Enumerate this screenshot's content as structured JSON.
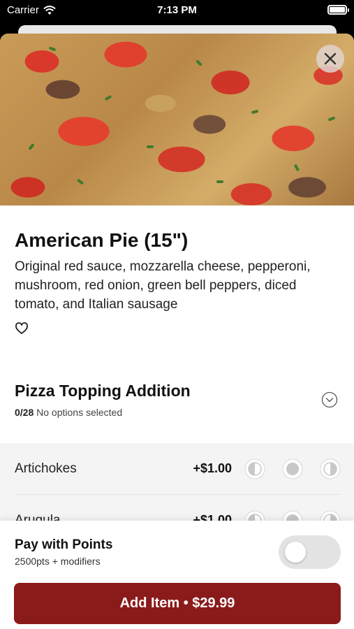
{
  "status_bar": {
    "carrier": "Carrier",
    "time": "7:13 PM"
  },
  "item": {
    "name": "American Pie (15\")",
    "description": "Original red sauce, mozzarella cheese, pepperoni, mushroom, red onion, green bell peppers, diced tomato, and Italian sausage",
    "favorite_icon": "heart-outline-icon",
    "close_icon": "close-icon"
  },
  "modifier_group": {
    "title": "Pizza Topping Addition",
    "count": "0/28",
    "status": "No options selected",
    "toggle_icon": "chevron-down-circle-icon"
  },
  "options": [
    {
      "name": "Artichokes",
      "price": "+$1.00",
      "placement_icons": [
        "left-half-icon",
        "whole-icon",
        "right-half-icon"
      ]
    },
    {
      "name": "Arugula",
      "price": "+$1.00",
      "placement_icons": [
        "left-half-icon",
        "whole-icon",
        "right-half-icon"
      ]
    }
  ],
  "footer": {
    "pay_title": "Pay with Points",
    "pay_sub": "2500pts + modifiers",
    "pay_toggle_on": false,
    "add_button": "Add Item • $29.99"
  },
  "colors": {
    "accent": "#8b1a1a",
    "options_bg": "#f4f4f4"
  }
}
